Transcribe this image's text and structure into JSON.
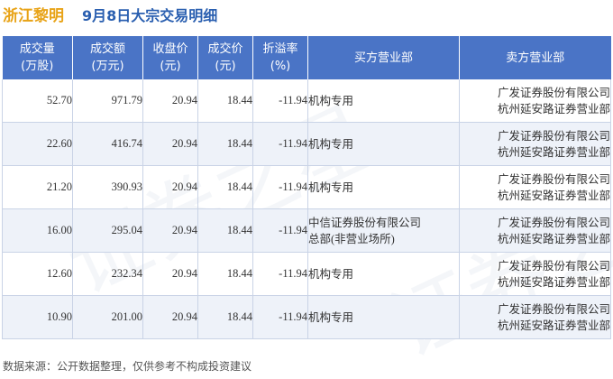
{
  "title": {
    "stock": "浙江黎明",
    "desc": "9月8日大宗交易明细"
  },
  "headers": [
    [
      "成交量",
      "(万股)"
    ],
    [
      "成交额",
      "(万元)"
    ],
    [
      "收盘价",
      "(元)"
    ],
    [
      "成交价",
      "(元)"
    ],
    [
      "折溢率",
      "(%)"
    ],
    [
      "买方营业部"
    ],
    [
      "卖方营业部"
    ]
  ],
  "rows": [
    {
      "volume": "52.70",
      "amount": "971.79",
      "close": "20.94",
      "price": "18.44",
      "premium": "-11.94",
      "buyer": [
        "机构专用"
      ],
      "seller": [
        "广发证券股份有限公司",
        "杭州延安路证券营业部"
      ]
    },
    {
      "volume": "22.60",
      "amount": "416.74",
      "close": "20.94",
      "price": "18.44",
      "premium": "-11.94",
      "buyer": [
        "机构专用"
      ],
      "seller": [
        "广发证券股份有限公司",
        "杭州延安路证券营业部"
      ]
    },
    {
      "volume": "21.20",
      "amount": "390.93",
      "close": "20.94",
      "price": "18.44",
      "premium": "-11.94",
      "buyer": [
        "机构专用"
      ],
      "seller": [
        "广发证券股份有限公司",
        "杭州延安路证券营业部"
      ]
    },
    {
      "volume": "16.00",
      "amount": "295.04",
      "close": "20.94",
      "price": "18.44",
      "premium": "-11.94",
      "buyer": [
        "中信证券股份有限公司",
        "总部(非营业场所)"
      ],
      "seller": [
        "广发证券股份有限公司",
        "杭州延安路证券营业部"
      ]
    },
    {
      "volume": "12.60",
      "amount": "232.34",
      "close": "20.94",
      "price": "18.44",
      "premium": "-11.94",
      "buyer": [
        "机构专用"
      ],
      "seller": [
        "广发证券股份有限公司",
        "杭州延安路证券营业部"
      ]
    },
    {
      "volume": "10.90",
      "amount": "201.00",
      "close": "20.94",
      "price": "18.44",
      "premium": "-11.94",
      "buyer": [
        "机构专用"
      ],
      "seller": [
        "广发证券股份有限公司",
        "杭州延安路证券营业部"
      ]
    }
  ],
  "footer": "数据来源：公开数据整理，仅供参考不构成投资建议",
  "colors": {
    "header_bg": "#4a74c6",
    "stock_title": "#e8a317",
    "desc_title": "#2a5fb0",
    "negative": "#1f9a3a"
  }
}
